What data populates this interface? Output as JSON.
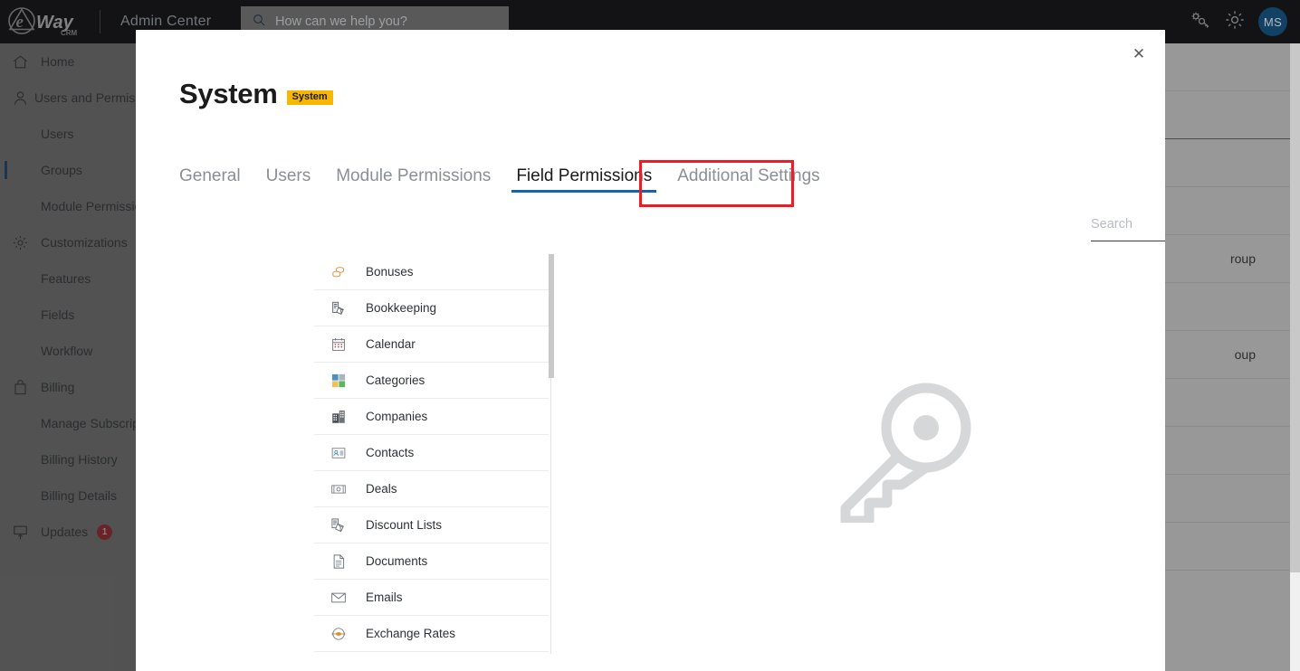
{
  "topbar": {
    "brand": "eWay",
    "brand_sub": "CRM",
    "app_name": "Admin Center",
    "search_placeholder": "How can we help you?",
    "search_icon": "search-icon",
    "gears_key_icon": "gears-key-icon",
    "gear_icon": "gear-icon",
    "avatar_initials": "MS",
    "avatar_color": "#185a8d"
  },
  "sidebar": {
    "active_item": "Groups",
    "background_color": "#7a7a7a",
    "active_indicator_color": "#12436b",
    "items": [
      {
        "label": "Home",
        "icon": "home-icon",
        "sub": false,
        "active": false
      },
      {
        "label": "Users and Permissions",
        "icon": "user-icon",
        "sub": false,
        "active": false
      },
      {
        "label": "Users",
        "icon": "",
        "sub": true,
        "active": false
      },
      {
        "label": "Groups",
        "icon": "",
        "sub": true,
        "active": true
      },
      {
        "label": "Module Permissions",
        "icon": "",
        "sub": true,
        "active": false
      },
      {
        "label": "Customizations",
        "icon": "gear-icon",
        "sub": false,
        "active": false
      },
      {
        "label": "Features",
        "icon": "",
        "sub": true,
        "active": false
      },
      {
        "label": "Fields",
        "icon": "",
        "sub": true,
        "active": false
      },
      {
        "label": "Workflow",
        "icon": "",
        "sub": true,
        "active": false
      },
      {
        "label": "Billing",
        "icon": "bag-icon",
        "sub": false,
        "active": false
      },
      {
        "label": "Manage Subscriptions",
        "icon": "",
        "sub": true,
        "active": false
      },
      {
        "label": "Billing History",
        "icon": "",
        "sub": true,
        "active": false
      },
      {
        "label": "Billing Details",
        "icon": "",
        "sub": true,
        "active": false
      },
      {
        "label": "Updates",
        "icon": "monitor-upload-icon",
        "sub": false,
        "active": false,
        "badge": "1"
      }
    ]
  },
  "background_table": {
    "rows": [
      "",
      "",
      "",
      "",
      "roup",
      "",
      "oup",
      "",
      "",
      "",
      ""
    ]
  },
  "modal": {
    "close_icon": "close-icon",
    "title": "System",
    "title_badge": "System",
    "title_badge_color": "#f7b600",
    "tabs": [
      {
        "label": "General",
        "active": false
      },
      {
        "label": "Users",
        "active": false
      },
      {
        "label": "Module Permissions",
        "active": false
      },
      {
        "label": "Field Permissions",
        "active": true
      },
      {
        "label": "Additional Settings",
        "active": false
      }
    ],
    "active_tab_underline_color": "#1565a8",
    "annotation_color": "#ee1c25",
    "search": {
      "placeholder": "Search",
      "value": ""
    },
    "watermark_icon": "key-icon",
    "watermark_color": "#d5d7d8",
    "modules": [
      {
        "label": "Bonuses",
        "icon": "bonuses-icon"
      },
      {
        "label": "Bookkeeping",
        "icon": "bookkeeping-icon"
      },
      {
        "label": "Calendar",
        "icon": "calendar-icon"
      },
      {
        "label": "Categories",
        "icon": "categories-icon"
      },
      {
        "label": "Companies",
        "icon": "companies-icon"
      },
      {
        "label": "Contacts",
        "icon": "contacts-icon"
      },
      {
        "label": "Deals",
        "icon": "deals-icon"
      },
      {
        "label": "Discount Lists",
        "icon": "discount-lists-icon"
      },
      {
        "label": "Documents",
        "icon": "documents-icon"
      },
      {
        "label": "Emails",
        "icon": "emails-icon"
      },
      {
        "label": "Exchange Rates",
        "icon": "exchange-rates-icon"
      }
    ]
  }
}
